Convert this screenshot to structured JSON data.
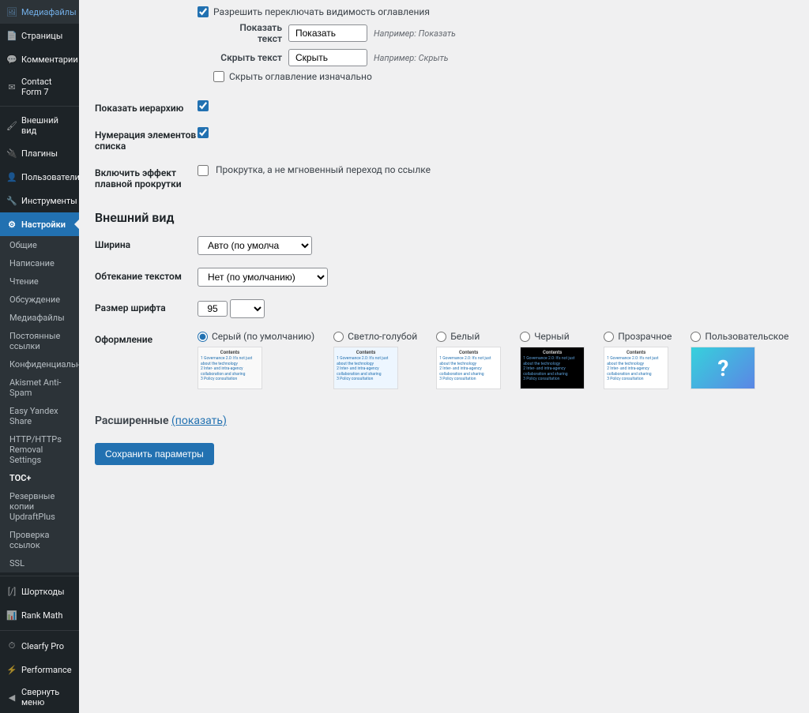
{
  "sidebar": {
    "media": "Медиафайлы",
    "pages": "Страницы",
    "comments": "Комментарии",
    "cf7": "Contact Form 7",
    "appearance": "Внешний вид",
    "plugins": "Плагины",
    "users": "Пользователи",
    "tools": "Инструменты",
    "settings": "Настройки",
    "sub": {
      "general": "Общие",
      "writing": "Написание",
      "reading": "Чтение",
      "discussion": "Обсуждение",
      "media": "Медиафайлы",
      "permalinks": "Постоянные ссылки",
      "privacy": "Конфиденциальность",
      "akismet": "Akismet Anti-Spam",
      "yandex": "Easy Yandex Share",
      "httpremoval": "HTTP/HTTPs Removal Settings",
      "toc": "TOC+",
      "updraft": "Резервные копии UpdraftPlus",
      "linkcheck": "Проверка ссылок",
      "ssl": "SSL"
    },
    "shortcodes": "Шорткоды",
    "rankmath": "Rank Math",
    "clearfy": "Clearfy Pro",
    "performance": "Performance",
    "collapse": "Свернуть меню"
  },
  "form": {
    "toggle_vis_label": "Разрешить переключать видимость оглавления",
    "show_label": "Показать текст",
    "show_value": "Показать",
    "show_hint": "Например: Показать",
    "hide_label": "Скрыть текст",
    "hide_value": "Скрыть",
    "hide_hint": "Например: Скрыть",
    "hide_initial": "Скрыть оглавление изначально",
    "hierarchy": "Показать иерархию",
    "numbering": "Нумерация элементов списка",
    "smooth_label": "Включить эффект плавной прокрутки",
    "smooth_desc": "Прокрутка, а не мгновенный переход по ссылке",
    "appearance_h": "Внешний вид",
    "width_label": "Ширина",
    "width_value": "Авто (по умолчанию)",
    "wrap_label": "Обтекание текстом",
    "wrap_value": "Нет (по умолчанию)",
    "fontsize_label": "Размер шрифта",
    "fontsize_value": "95",
    "fontsize_unit": "%",
    "pres_label": "Оформление",
    "pres": {
      "grey": "Серый (по умолчанию)",
      "lightblue": "Светло-голубой",
      "white": "Белый",
      "black": "Черный",
      "trans": "Прозрачное",
      "custom": "Пользовательское"
    },
    "advanced": "Расширенные",
    "advanced_show": "(показать)",
    "save": "Сохранить параметры"
  }
}
